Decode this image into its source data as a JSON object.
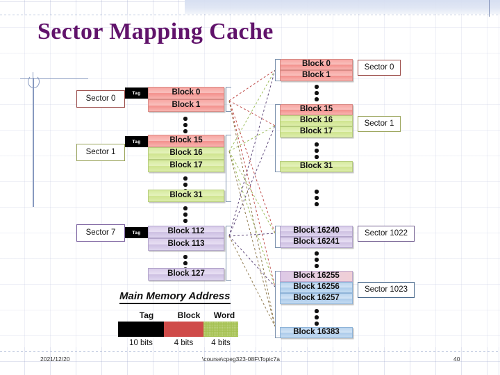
{
  "slide": {
    "title": "Sector Mapping Cache",
    "title_color": "#61136b"
  },
  "cache": {
    "label": "cache-side",
    "sectors": [
      {
        "name": "Sector 0",
        "tag": "Tag",
        "border_color": "#9b4a47"
      },
      {
        "name": "Sector 1",
        "tag": "Tag",
        "border_color": "#9aa45a"
      },
      {
        "name": "Sector 7",
        "tag": "Tag",
        "border_color": "#7a5f9e"
      }
    ],
    "blocks": [
      {
        "text": "Block 0",
        "color": "pink"
      },
      {
        "text": "Block 1",
        "color": "pink"
      },
      {
        "text": "Block 15",
        "color": "pink"
      },
      {
        "text": "Block 16",
        "color": "green"
      },
      {
        "text": "Block 17",
        "color": "green"
      },
      {
        "text": "Block 31",
        "color": "green"
      },
      {
        "text": "Block 112",
        "color": "purple"
      },
      {
        "text": "Block 113",
        "color": "purple"
      },
      {
        "text": "Block 127",
        "color": "purple"
      }
    ]
  },
  "memory": {
    "label": "main-memory-side",
    "sectors": [
      {
        "name": "Sector 0",
        "border_color": "#9b4a47"
      },
      {
        "name": "Sector 1",
        "border_color": "#9aa45a"
      },
      {
        "name": "Sector 1022",
        "border_color": "#6f5b8e"
      },
      {
        "name": "Sector 1023",
        "border_color": "#49698c"
      }
    ],
    "blocks": [
      {
        "text": "Block 0",
        "color": "pink"
      },
      {
        "text": "Block 1",
        "color": "pink"
      },
      {
        "text": "Block 15",
        "color": "pink"
      },
      {
        "text": "Block 16",
        "color": "green"
      },
      {
        "text": "Block 17",
        "color": "green"
      },
      {
        "text": "Block 31",
        "color": "green"
      },
      {
        "text": "Block 16240",
        "color": "purple"
      },
      {
        "text": "Block 16241",
        "color": "purple"
      },
      {
        "text": "Block 16255",
        "color": "pinkpurple"
      },
      {
        "text": "Block 16256",
        "color": "blue"
      },
      {
        "text": "Block 16257",
        "color": "blue"
      },
      {
        "text": "Block 16383",
        "color": "blue"
      }
    ]
  },
  "address": {
    "heading": "Main Memory Address",
    "fields": [
      {
        "label": "Tag",
        "bits": "10 bits",
        "color": "#000000"
      },
      {
        "label": "Block",
        "bits": "4 bits",
        "color": "#cf4b49"
      },
      {
        "label": "Word",
        "bits": "4 bits",
        "color": "#a6c253"
      }
    ]
  },
  "footer": {
    "date": "2021/12/20",
    "path": "\\course\\cpeg323-08F\\Topic7a",
    "page": "40"
  }
}
